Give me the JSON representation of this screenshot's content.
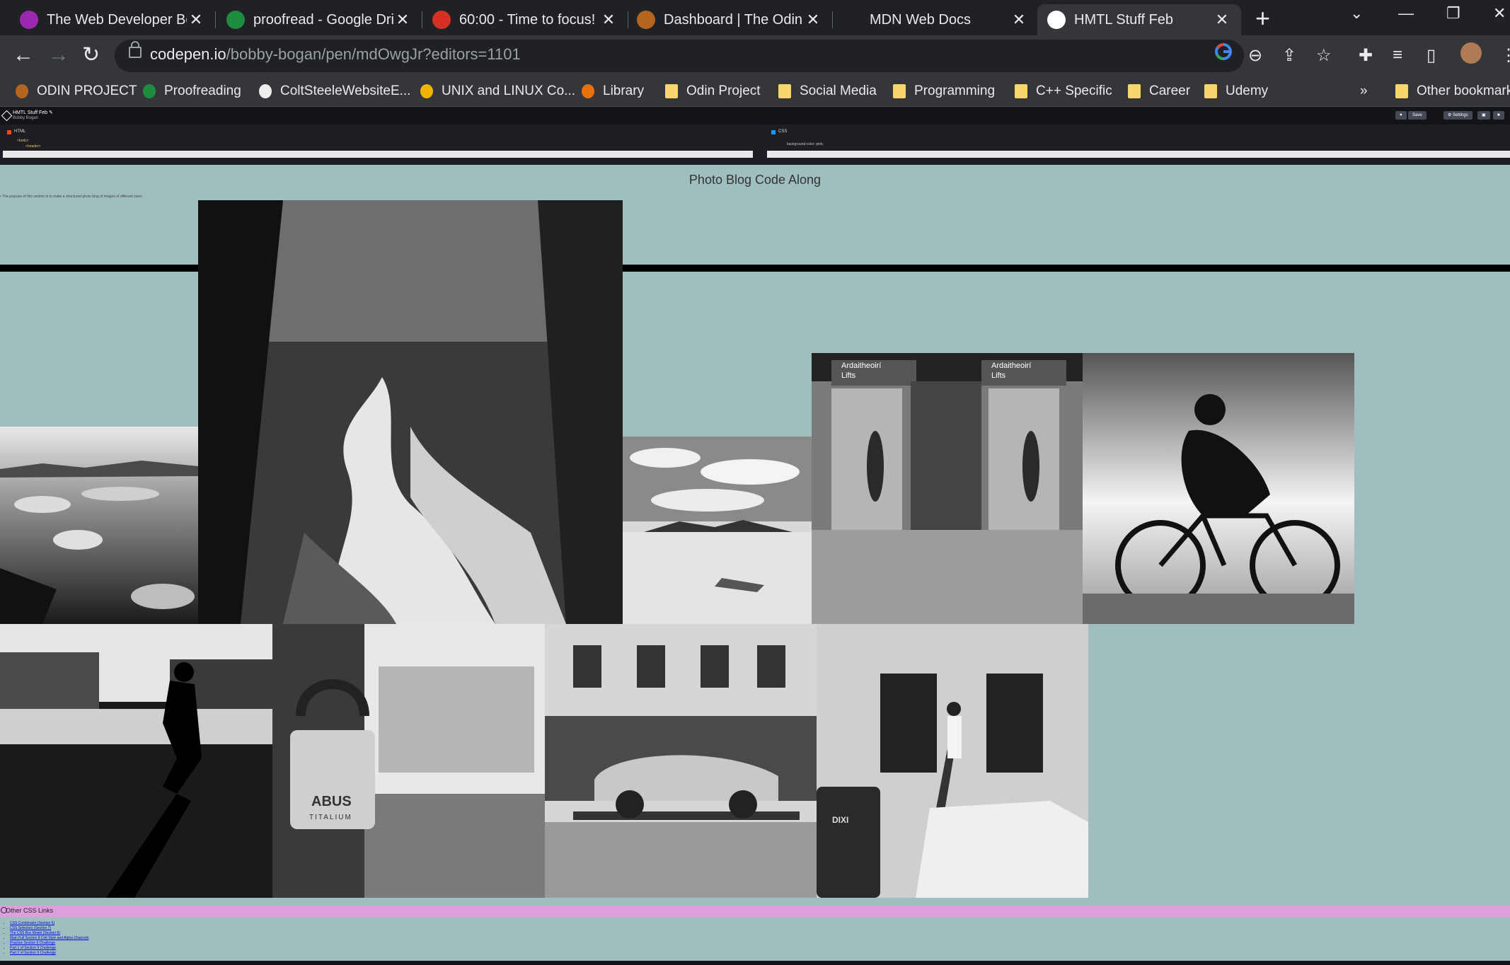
{
  "browser": {
    "tabs": [
      {
        "title": "The Web Developer Boo",
        "icon": "odin-project-favicon",
        "color": "#9c27b0"
      },
      {
        "title": "proofread - Google Driv",
        "icon": "google-drive-icon",
        "color": "#1e8e3e"
      },
      {
        "title": "60:00 - Time to focus!",
        "icon": "pomodoro-check-icon",
        "color": "#d93025"
      },
      {
        "title": "Dashboard | The Odin Pr",
        "icon": "odin-project-favicon",
        "color": "#b5651d"
      },
      {
        "title": "MDN Web Docs",
        "icon": "mdn-icon",
        "color": "#202124"
      },
      {
        "title": "HMTL Stuff Feb",
        "icon": "codepen-icon",
        "color": "#ffffff"
      }
    ],
    "url_host": "codepen.io",
    "url_path": "/bobby-bogan/pen/mdOwgJr?editors=1101",
    "bookmarks": [
      {
        "label": "ODIN PROJECT",
        "icon": "odin-project-favicon"
      },
      {
        "label": "Proofreading",
        "icon": "google-drive-icon"
      },
      {
        "label": "ColtSteeleWebsiteE...",
        "icon": "colt-steele-icon"
      },
      {
        "label": "UNIX and LINUX Co...",
        "icon": "circle-o-icon"
      },
      {
        "label": "Library",
        "icon": "library-icon"
      },
      {
        "label": "Odin Project",
        "icon": "folder-icon"
      },
      {
        "label": "Social Media",
        "icon": "folder-icon"
      },
      {
        "label": "Programming",
        "icon": "folder-icon"
      },
      {
        "label": "C++ Specific",
        "icon": "folder-icon"
      },
      {
        "label": "Career",
        "icon": "folder-icon"
      },
      {
        "label": "Udemy",
        "icon": "folder-icon"
      }
    ],
    "overflow_label": "»",
    "other_bookmarks": "Other bookmarks"
  },
  "codepen": {
    "title": "HMTL Stuff Feb ✎",
    "user": "Bobby Bogan",
    "buttons": [
      "♥",
      "Save",
      "⚙ Settings",
      "▣",
      "■"
    ],
    "html_tab": "HTML",
    "css_tab": "CSS",
    "html_code_1": "<body>",
    "html_code_2": "<header>",
    "css_code": "background-color: pink;"
  },
  "page": {
    "title": "Photo Blog Code Along",
    "intro": "The purpose of this section is to make a structured photo blog of images of different sizes",
    "photos": [
      {
        "name": "photo-icebergs",
        "subject": "icebergs",
        "tone": "#8a8a8a"
      },
      {
        "name": "photo-waterfall",
        "subject": "waterfall",
        "tone": "#6a6a6a"
      },
      {
        "name": "photo-desert",
        "subject": "desert",
        "tone": "#bdbdbd"
      },
      {
        "name": "photo-lifts",
        "subject": "lifts",
        "tone": "#9a9a9a"
      },
      {
        "name": "photo-cyclist",
        "subject": "cyclist",
        "tone": "#b0b0b0"
      },
      {
        "name": "photo-walker",
        "subject": "walker",
        "tone": "#555555"
      },
      {
        "name": "photo-padlock",
        "subject": "padlock",
        "tone": "#8e8e8e"
      },
      {
        "name": "photo-car-trailer",
        "subject": "car",
        "tone": "#a8a8a8"
      },
      {
        "name": "photo-painter-van",
        "subject": "van",
        "tone": "#b8b8b8"
      }
    ],
    "lift_sign_1": "Ardaitheoirí",
    "lift_sign_2": "Lifts",
    "padlock_brand": "ABUS",
    "padlock_model": "TITALIUM",
    "toilet_brand": "DIXI"
  },
  "links": {
    "title": "Other CSS Links",
    "items": [
      "CSS Combinator (Section 6)",
      "CSS Selectors (Section 7)",
      "The CSS Box Model (Section 8)",
      "Main Full Section 8 Colt Style and Alpha Channels",
      "Practice Section 9 Challenge",
      "Part 1 of Section 9 Challenge",
      "Part 2 of Section 9 Challenge"
    ]
  }
}
